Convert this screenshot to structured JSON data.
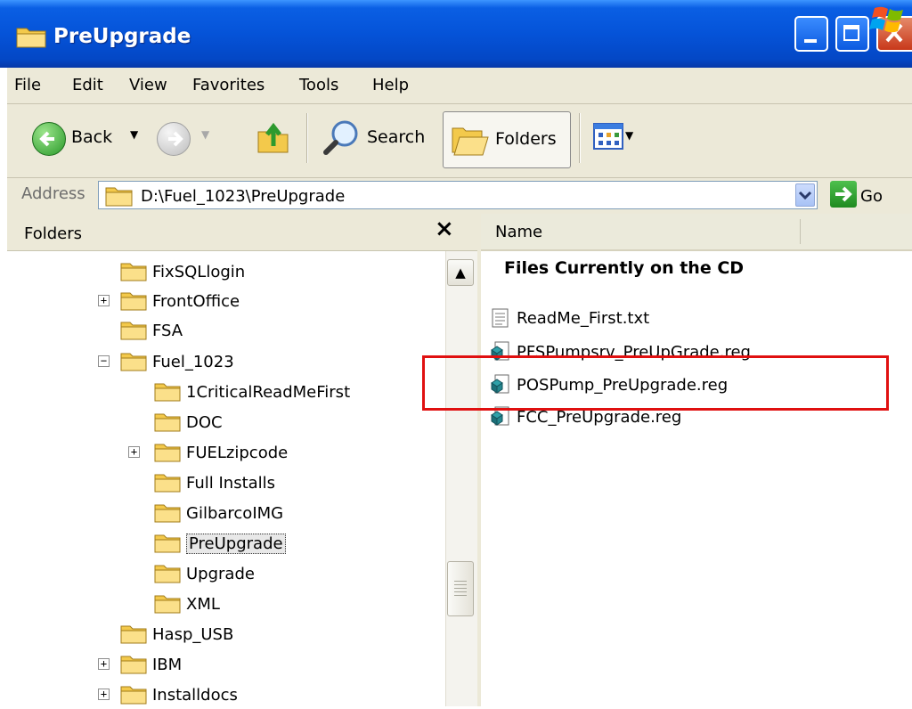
{
  "window": {
    "title": "PreUpgrade"
  },
  "menu": [
    "File",
    "Edit",
    "View",
    "Favorites",
    "Tools",
    "Help"
  ],
  "toolbar": {
    "back_label": "Back",
    "search_label": "Search",
    "folders_label": "Folders"
  },
  "address": {
    "label": "Address",
    "value": "D:\\Fuel_1023\\PreUpgrade",
    "go_label": "Go"
  },
  "folders_pane": {
    "title": "Folders",
    "items": [
      {
        "label": "FixSQLlogin",
        "expander": ""
      },
      {
        "label": "FrontOffice",
        "expander": "+"
      },
      {
        "label": "FSA",
        "expander": ""
      },
      {
        "label": "Fuel_1023",
        "expander": "−"
      },
      {
        "label": "1CriticalReadMeFirst",
        "expander": ""
      },
      {
        "label": "DOC",
        "expander": ""
      },
      {
        "label": "FUELzipcode",
        "expander": "+"
      },
      {
        "label": "Full Installs",
        "expander": ""
      },
      {
        "label": "GilbarcoIMG",
        "expander": ""
      },
      {
        "label": "PreUpgrade",
        "expander": ""
      },
      {
        "label": "Upgrade",
        "expander": ""
      },
      {
        "label": "XML",
        "expander": ""
      },
      {
        "label": "Hasp_USB",
        "expander": ""
      },
      {
        "label": "IBM",
        "expander": "+"
      },
      {
        "label": "Installdocs",
        "expander": "+"
      }
    ]
  },
  "files_pane": {
    "column_name": "Name",
    "group_title": "Files Currently on the CD",
    "files": [
      {
        "name": "ReadMe_First.txt",
        "icon": "text-file-icon"
      },
      {
        "name": "PFSPumpsrv_PreUpGrade.reg",
        "icon": "registry-file-icon"
      },
      {
        "name": "POSPump_PreUpgrade.reg",
        "icon": "registry-file-icon"
      },
      {
        "name": "FCC_PreUpgrade.reg",
        "icon": "registry-file-icon"
      }
    ]
  },
  "colors": {
    "titlebar": "#0553d8",
    "highlight": "#e01010",
    "chrome": "#ece9d8"
  }
}
